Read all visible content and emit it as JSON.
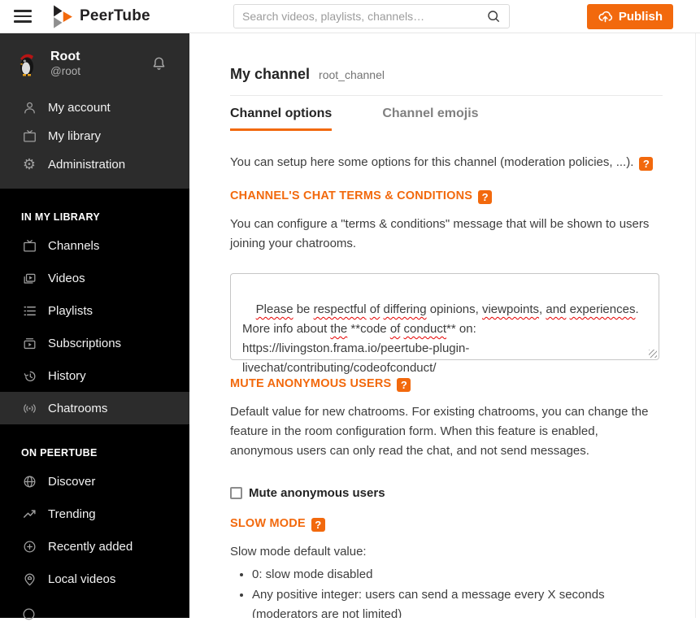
{
  "header": {
    "brand": "PeerTube",
    "search_placeholder": "Search videos, playlists, channels…",
    "publish_label": "Publish"
  },
  "sidebar": {
    "user": {
      "name": "Root",
      "handle": "@root"
    },
    "account_items": [
      {
        "label": "My account",
        "icon": "user-icon"
      },
      {
        "label": "My library",
        "icon": "tv-icon"
      },
      {
        "label": "Administration",
        "icon": "gear-icon"
      }
    ],
    "sections": [
      {
        "title": "IN MY LIBRARY",
        "items": [
          {
            "label": "Channels",
            "icon": "tv-icon"
          },
          {
            "label": "Videos",
            "icon": "videos-icon"
          },
          {
            "label": "Playlists",
            "icon": "playlist-icon"
          },
          {
            "label": "Subscriptions",
            "icon": "subscriptions-icon"
          },
          {
            "label": "History",
            "icon": "history-icon"
          },
          {
            "label": "Chatrooms",
            "icon": "chatrooms-icon",
            "active": true
          }
        ]
      },
      {
        "title": "ON PEERTUBE",
        "items": [
          {
            "label": "Discover",
            "icon": "globe-icon"
          },
          {
            "label": "Trending",
            "icon": "trending-icon"
          },
          {
            "label": "Recently added",
            "icon": "plus-circle-icon"
          },
          {
            "label": "Local videos",
            "icon": "map-pin-icon"
          }
        ]
      }
    ]
  },
  "main": {
    "title": "My channel",
    "subtitle": "root_channel",
    "tabs": [
      {
        "label": "Channel options",
        "active": true
      },
      {
        "label": "Channel emojis",
        "active": false
      }
    ],
    "help_badge": "?",
    "intro": "You can setup here some options for this channel (moderation policies, ...).",
    "terms": {
      "heading": "CHANNEL'S CHAT TERMS & CONDITIONS",
      "description": "You can configure a \"terms & conditions\" message that will be shown to users joining your chatrooms.",
      "textarea_value": "Please be respectful of differing opinions, viewpoints, and experiences.\nMore info about the **code of conduct** on: https://livingston.frama.io/peertube-plugin-livechat/contributing/codeofconduct/",
      "textarea_tokens": [
        {
          "text": "Please",
          "misspelled": true
        },
        {
          "text": " be "
        },
        {
          "text": "respectful",
          "misspelled": true
        },
        {
          "text": " "
        },
        {
          "text": "of",
          "misspelled": true
        },
        {
          "text": " "
        },
        {
          "text": "differing",
          "misspelled": true
        },
        {
          "text": " opinions, "
        },
        {
          "text": "viewpoints",
          "misspelled": true
        },
        {
          "text": ", "
        },
        {
          "text": "and",
          "misspelled": true
        },
        {
          "text": " "
        },
        {
          "text": "experiences",
          "misspelled": true
        },
        {
          "text": ".\nMore info about "
        },
        {
          "text": "the",
          "misspelled": true
        },
        {
          "text": " **code "
        },
        {
          "text": "of",
          "misspelled": true
        },
        {
          "text": " "
        },
        {
          "text": "conduct",
          "misspelled": true
        },
        {
          "text": "** on: https://livingston.frama.io/peertube-plugin-livechat/contributing/codeofconduct/"
        }
      ]
    },
    "mute": {
      "heading": "MUTE ANONYMOUS USERS",
      "description": "Default value for new chatrooms. For existing chatrooms, you can change the feature in the room configuration form. When this feature is enabled, anonymous users can only read the chat, and not send messages.",
      "checkbox_label": "Mute anonymous users",
      "checkbox_checked": false
    },
    "slow_mode": {
      "heading": "SLOW MODE",
      "description": "Slow mode default value:",
      "bullets": [
        "0: slow mode disabled",
        "Any positive integer: users can send a message every X seconds (moderators are not limited)"
      ]
    }
  },
  "colors": {
    "accent": "#f2690d",
    "sidebar_bg": "#000000",
    "sidebar_block_bg": "#2c2c2c",
    "spellcheck_red": "#e60000"
  }
}
